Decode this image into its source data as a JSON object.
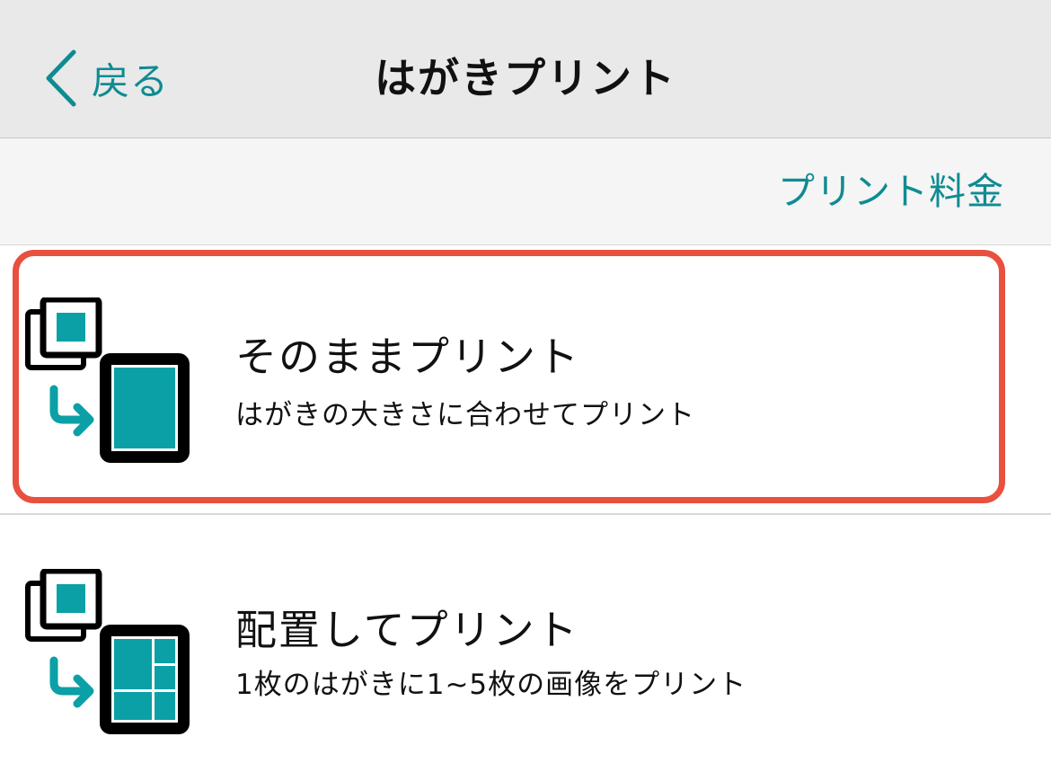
{
  "nav": {
    "back_label": "戻る",
    "title": "はがきプリント"
  },
  "subbar": {
    "price_label": "プリント料金"
  },
  "options": [
    {
      "title": "そのままプリント",
      "description": "はがきの大きさに合わせてプリント",
      "icon": "single-photo-print-icon"
    },
    {
      "title": "配置してプリント",
      "description": "1枚のはがきに1~5枚の画像をプリント",
      "icon": "layout-photo-print-icon"
    }
  ],
  "colors": {
    "accent": "#0f8b92",
    "icon_fill": "#0aa0a6",
    "highlight": "#e8503f",
    "navbar_bg": "#e9e9e9"
  }
}
